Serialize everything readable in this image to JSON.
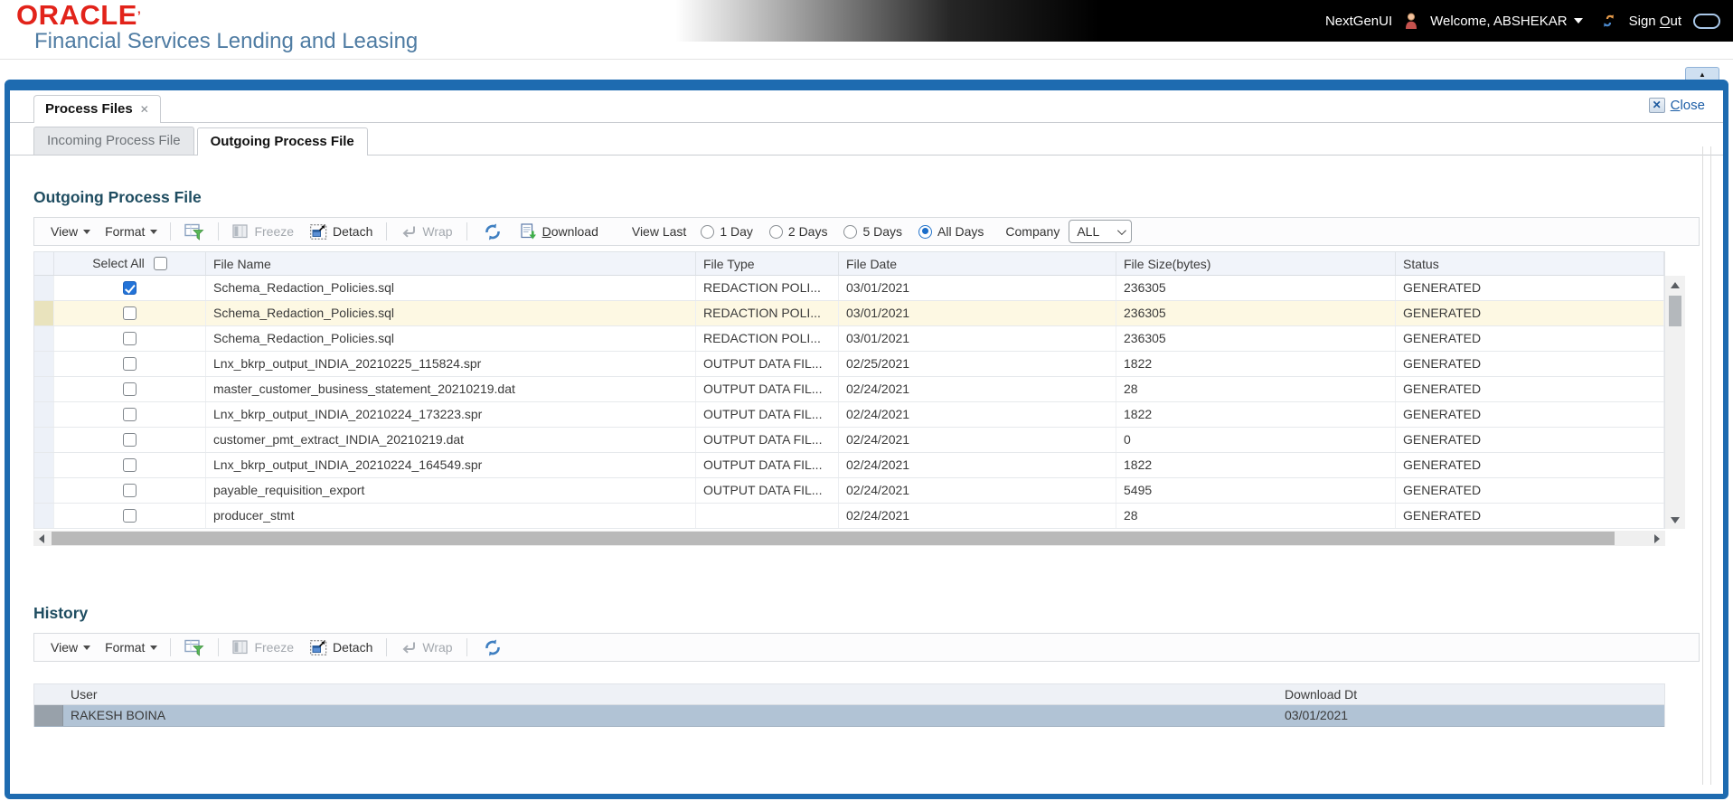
{
  "header": {
    "logo": "ORACLE",
    "logo_mark": "’",
    "subtitle": "Financial Services Lending and Leasing",
    "nextgen_label": "NextGenUI",
    "welcome_label": "Welcome, ABSHEKAR",
    "sign_out": {
      "pre": "Sign ",
      "key": "O",
      "rest": "ut"
    }
  },
  "window": {
    "doc_tab_label": "Process Files",
    "close": {
      "key": "C",
      "rest": "lose"
    }
  },
  "icons": {
    "tab_close": "✕",
    "close_x": "✕",
    "collapse": "▲",
    "splitter": "▶"
  },
  "tabs": [
    {
      "label": "Incoming Process File",
      "active": false
    },
    {
      "label": "Outgoing Process File",
      "active": true
    }
  ],
  "outgoing": {
    "title": "Outgoing Process File",
    "toolbar": {
      "view": "View",
      "format": "Format",
      "freeze": "Freeze",
      "detach": "Detach",
      "wrap": "Wrap",
      "download": {
        "key": "D",
        "rest": "ownload"
      },
      "view_last_label": "View Last",
      "radios": [
        {
          "label": "1 Day",
          "selected": false
        },
        {
          "label": "2 Days",
          "selected": false
        },
        {
          "label": "5 Days",
          "selected": false
        },
        {
          "label": "All Days",
          "selected": true
        }
      ],
      "company_label": "Company",
      "company_value": "ALL"
    },
    "table": {
      "select_all_label": "Select All",
      "columns": {
        "file_name": "File Name",
        "file_type": "File Type",
        "file_date": "File Date",
        "file_size": "File Size(bytes)",
        "status": "Status"
      },
      "rows": [
        {
          "checked": true,
          "current": false,
          "file_name": "Schema_Redaction_Policies.sql",
          "file_type": "REDACTION POLI...",
          "file_date": "03/01/2021",
          "file_size": "236305",
          "status": "GENERATED"
        },
        {
          "checked": false,
          "current": true,
          "file_name": "Schema_Redaction_Policies.sql",
          "file_type": "REDACTION POLI...",
          "file_date": "03/01/2021",
          "file_size": "236305",
          "status": "GENERATED"
        },
        {
          "checked": false,
          "current": false,
          "file_name": "Schema_Redaction_Policies.sql",
          "file_type": "REDACTION POLI...",
          "file_date": "03/01/2021",
          "file_size": "236305",
          "status": "GENERATED"
        },
        {
          "checked": false,
          "current": false,
          "file_name": "Lnx_bkrp_output_INDIA_20210225_115824.spr",
          "file_type": "OUTPUT DATA FIL...",
          "file_date": "02/25/2021",
          "file_size": "1822",
          "status": "GENERATED"
        },
        {
          "checked": false,
          "current": false,
          "file_name": "master_customer_business_statement_20210219.dat",
          "file_type": "OUTPUT DATA FIL...",
          "file_date": "02/24/2021",
          "file_size": "28",
          "status": "GENERATED"
        },
        {
          "checked": false,
          "current": false,
          "file_name": "Lnx_bkrp_output_INDIA_20210224_173223.spr",
          "file_type": "OUTPUT DATA FIL...",
          "file_date": "02/24/2021",
          "file_size": "1822",
          "status": "GENERATED"
        },
        {
          "checked": false,
          "current": false,
          "file_name": "customer_pmt_extract_INDIA_20210219.dat",
          "file_type": "OUTPUT DATA FIL...",
          "file_date": "02/24/2021",
          "file_size": "0",
          "status": "GENERATED"
        },
        {
          "checked": false,
          "current": false,
          "file_name": "Lnx_bkrp_output_INDIA_20210224_164549.spr",
          "file_type": "OUTPUT DATA FIL...",
          "file_date": "02/24/2021",
          "file_size": "1822",
          "status": "GENERATED"
        },
        {
          "checked": false,
          "current": false,
          "file_name": "payable_requisition_export",
          "file_type": "OUTPUT DATA FIL...",
          "file_date": "02/24/2021",
          "file_size": "5495",
          "status": "GENERATED"
        },
        {
          "checked": false,
          "current": false,
          "file_name": "producer_stmt",
          "file_type": "",
          "file_date": "02/24/2021",
          "file_size": "28",
          "status": "GENERATED"
        }
      ]
    }
  },
  "history": {
    "title": "History",
    "toolbar": {
      "view": "View",
      "format": "Format",
      "freeze": "Freeze",
      "detach": "Detach",
      "wrap": "Wrap"
    },
    "columns": {
      "user": "User",
      "download_dt": "Download Dt"
    },
    "rows": [
      {
        "user": "RAKESH BOINA",
        "download_dt": "03/01/2021"
      }
    ]
  },
  "colors": {
    "frame_blue": "#1e6bb0",
    "oracle_red": "#e2231a",
    "subtitle_blue": "#4f7ca3",
    "section_title": "#1f4d61",
    "current_row_bg": "#fdf8e3",
    "history_selected_bg": "#b1c3d5",
    "checkbox_checked": "#2273d8",
    "radio_selected": "#1b6dc9"
  }
}
